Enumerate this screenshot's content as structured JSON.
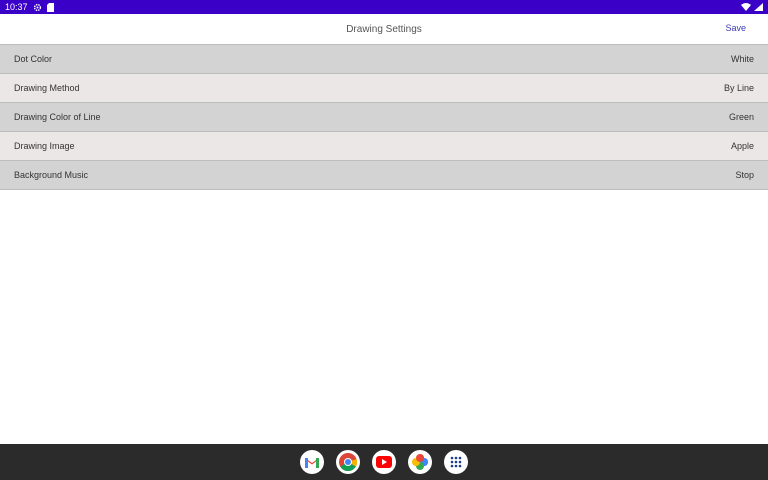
{
  "status_bar": {
    "time": "10:37",
    "icons": [
      "settings-icon",
      "sim-card-icon",
      "wifi-icon",
      "battery-icon"
    ]
  },
  "app_bar": {
    "title": "Drawing Settings",
    "save_label": "Save"
  },
  "settings": [
    {
      "label": "Dot Color",
      "value": "White"
    },
    {
      "label": "Drawing Method",
      "value": "By Line"
    },
    {
      "label": "Drawing Color of Line",
      "value": "Green"
    },
    {
      "label": "Drawing Image",
      "value": "Apple"
    },
    {
      "label": "Background Music",
      "value": "Stop"
    }
  ],
  "taskbar": {
    "apps": [
      "gmail-icon",
      "chrome-icon",
      "youtube-icon",
      "photos-icon",
      "app-drawer-icon"
    ]
  },
  "colors": {
    "status_bar": "#3a00c8",
    "row_dark": "#d3d3d3",
    "row_light": "#ebe7e7",
    "accent": "#3b3bb0",
    "taskbar": "#2b2b2b"
  }
}
